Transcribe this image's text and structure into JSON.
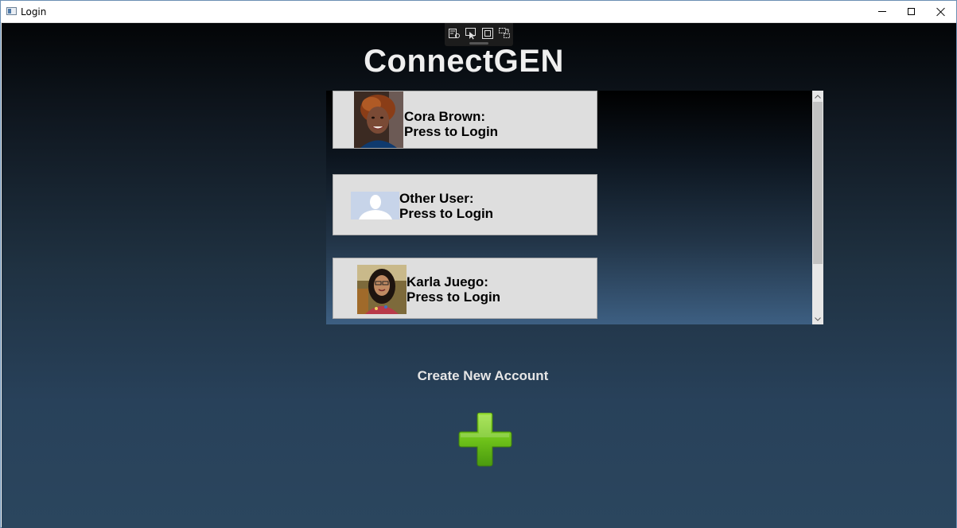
{
  "window": {
    "title": "Login"
  },
  "app": {
    "logo": "ConnectGEN"
  },
  "users": [
    {
      "name": "Cora Brown:",
      "action": "Press to Login",
      "avatar": "user-photo-cora-brown"
    },
    {
      "name": "Other User:",
      "action": "Press to Login",
      "avatar": "default-user-silhouette"
    },
    {
      "name": "Karla Juego:",
      "action": "Press to Login",
      "avatar": "user-photo-karla-juego"
    }
  ],
  "create_account": {
    "label": "Create New Account",
    "icon": "plus-icon",
    "color": "#6fc31a"
  },
  "colors": {
    "card_bg": "#dedede",
    "accent_green": "#6fc31a"
  }
}
